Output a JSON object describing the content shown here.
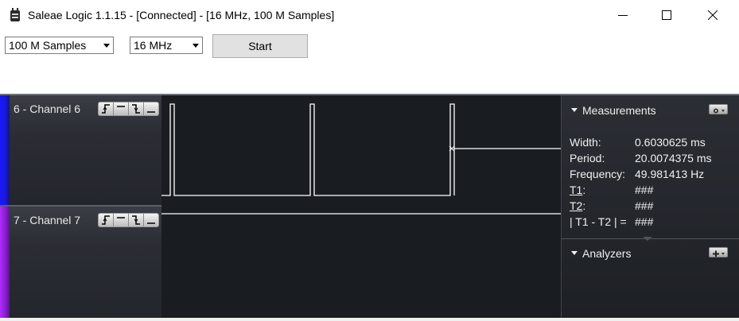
{
  "window": {
    "title": "Saleae Logic 1.1.15 - [Connected] - [16 MHz, 100 M Samples]",
    "icon": "saleae-app-icon"
  },
  "toolbar": {
    "samples_selected": "100 M Samples",
    "rate_selected": "16 MHz",
    "start_label": "Start"
  },
  "channels": [
    {
      "label": "6 - Channel 6",
      "color": "#1a1ad6"
    },
    {
      "label": "7 - Channel 7",
      "color": "#8a1fd1"
    }
  ],
  "trigger_icons": [
    "rising-edge-icon",
    "high-level-icon",
    "falling-edge-icon",
    "low-level-icon"
  ],
  "measurements": {
    "title": "Measurements",
    "rows": [
      {
        "label": "Width:",
        "value": "0.6030625 ms"
      },
      {
        "label": "Period:",
        "value": "20.0074375 ms"
      },
      {
        "label": "Frequency:",
        "value": "49.981413 Hz"
      },
      {
        "label": "T1",
        "suffix": ":",
        "value": "###"
      },
      {
        "label": "T2",
        "suffix": ":",
        "value": "###"
      },
      {
        "label": "| T1 - T2 | =",
        "value": "###"
      }
    ]
  },
  "analyzers": {
    "title": "Analyzers"
  },
  "colors": {
    "panel_bg": "#191c21",
    "signal": "#ffffff"
  }
}
